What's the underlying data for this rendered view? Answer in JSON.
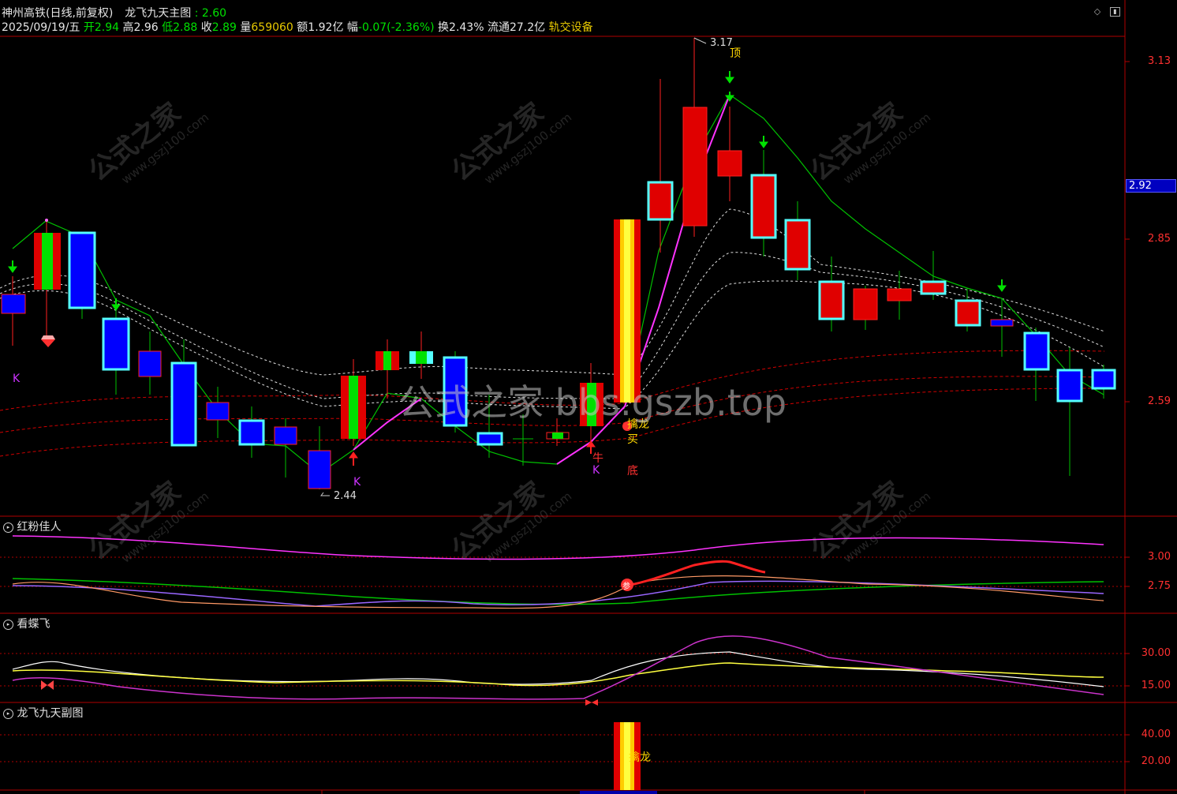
{
  "header": {
    "stock_name": "神州高铁(日线,前复权)",
    "indicator_name": "龙飞九天主图",
    "indicator_value": ": 2.60",
    "date": "2025/09/19/五",
    "open_label": "开",
    "open_value": "2.94",
    "high_label": "高",
    "high_value": "2.96",
    "low_label": "低",
    "low_value": "2.88",
    "close_label": "收",
    "close_value": "2.89",
    "volume_label": "量",
    "volume_value": "659060",
    "amount_label": "额",
    "amount_value": "1.92亿",
    "change_label": "幅",
    "change_value": "-0.07(-2.36%)",
    "turnover_label": "换",
    "turnover_value": "2.43%",
    "float_label": "流通",
    "float_value": "27.2亿",
    "sector": "轨交设备"
  },
  "main_axis": {
    "labels": [
      "3.13",
      "2.85",
      "2.59"
    ],
    "current_price": "2.92"
  },
  "annotations": {
    "high_mark": "3.17",
    "low_mark": "2.44",
    "top": "顶",
    "bottom": "底",
    "k1": "K",
    "k2": "K",
    "k3": "K",
    "niu": "牛",
    "qianlong": "擒龙",
    "buy": "买"
  },
  "panels": {
    "p1_title": "红粉佳人",
    "p1_axis": [
      "3.00",
      "2.75"
    ],
    "p1_marker": "参",
    "p2_title": "看蝶飞",
    "p2_axis": [
      "30.00",
      "15.00"
    ],
    "p3_title": "龙飞九天副图",
    "p3_axis": [
      "40.00",
      "20.00"
    ],
    "p3_label": "擒龙"
  },
  "watermarks": {
    "site_cn": "公式之家",
    "site_url": "www.gszj100.com",
    "center": "公式之家 bbs.gszb.top"
  },
  "colors": {
    "up": "#ff0000",
    "down": "#0000ff",
    "cyan": "#5ff",
    "green": "#00cc00",
    "magenta": "#ff33ff",
    "axis": "#cc0000"
  }
}
